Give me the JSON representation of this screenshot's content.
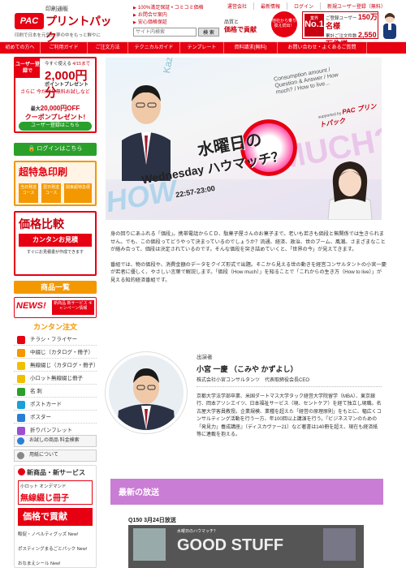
{
  "header": {
    "logo_sub": "印刷通販",
    "logo_mark": "PAC",
    "logo_text": "プリントパック",
    "logo_tagline": "印刷で日本を元気に 夢の中をもっと鮮やに",
    "links": [
      "100%満足保証 • コミコミ価格",
      "お問合せ案内",
      "安心価格保証"
    ],
    "search_placeholder": "サイト内検索",
    "search_button": "検 索",
    "top_links": [
      "運営会社",
      "最新情報",
      "ログイン",
      "新規ユーザー登録（無料）"
    ],
    "quality_label": "品質と",
    "quality_big": "価格で貢献",
    "circle_text": "他社から乗り換え続出！",
    "no1_label": "業界",
    "no1_big": "No.1",
    "no1_line1": "ご登録ユーザー",
    "no1_count": "150万名様",
    "no1_line2": "累計ご注文件数",
    "no1_orders": "2,550万件様"
  },
  "nav": {
    "items": [
      "初めての方へ",
      "ご利用ガイド",
      "ご注文方法",
      "テクニカルガイド",
      "テンプレート",
      "資料請求(無料)",
      "お問い合わせ・よくあるご質問"
    ]
  },
  "sidebar": {
    "user_tag": "ユーザー登録で",
    "user_today": "今すぐ使える",
    "user_date": "4/15まで",
    "user_amount": "2,000円分",
    "user_points": "ポイントプレゼント",
    "user_sep": "さらに 今だけ！無料お試しなど",
    "user_coupon_pre": "最大",
    "user_coupon": "20,000円OFF",
    "user_coupon2": "クーポンプレゼント!",
    "user_register": "ユーザー登録はこちら",
    "login": "ログインはこちら",
    "express": "超特急印刷",
    "express_opts": [
      "当日発送コース",
      "翌日発送コース",
      "関東超特急便"
    ],
    "compare_title": "価格比較",
    "compare_sub": "カンタンお見積",
    "compare_desc": "すぐにお見積書が作成できます",
    "list_head": "商品一覧",
    "news": "NEWS!",
    "news_sub": "新商品 新サービス キャンペーン情報",
    "kantan": "カンタン注文",
    "products": [
      {
        "label": "チラシ・フライヤー",
        "color": "#e60012"
      },
      {
        "label": "中綴じ（カタログ・冊子）",
        "color": "#f39800"
      },
      {
        "label": "無線綴じ（カタログ・冊子）",
        "color": "#f0c000"
      },
      {
        "label": "小ロット無線綴じ冊子",
        "color": "#f0c000"
      },
      {
        "label": "名 刺",
        "color": "#2aa02a"
      },
      {
        "label": "ポストカード",
        "color": "#1aa0d8"
      },
      {
        "label": "ポスター",
        "color": "#2a7fd4"
      },
      {
        "label": "折りパンフレット",
        "color": "#9a4fd0"
      }
    ],
    "bottom_links": [
      "お試しの商品 料金検索",
      "用紙について"
    ],
    "new_services": "新商品・新サービス",
    "ns_lot": "小ロット オンデマンド",
    "ns_lot_big": "無線綴じ冊子",
    "ns_price": "価格で貢献",
    "ns_links": [
      "販促・ノベルティグッズ New!",
      "ポスティングまるごとパック New!",
      "おなまえシール New!"
    ]
  },
  "hero": {
    "title1": "水曜日の",
    "title2": "ハウマッチ？",
    "day": "Wednesday",
    "time": "22:57-23:00",
    "how": "HOW",
    "much": "MUCH?",
    "eng": "Consumption amount / Question & Answer / How much? / How to live...",
    "supported": "supported by",
    "supported_brand": "PAC プリントパック",
    "name_vertical": "Kazuyoshi Komiya"
  },
  "description": {
    "p1": "身の回りにあふれる「価段」。携帯電話からＣＤ、駄菓子屋さんのお菓子まで。老いも若きも価段と無関係では生きられません。でも、この価段ってどうやって決まっているのでしょうか？流通、経済、政治、世のブーム、風潮。さまざまなことが絡み合って、価段は決定されているのです。そんな価段を突き詰めていくと、「世界の今」が見えてきます。",
    "p2": "番組では、物の価段や、消費金額のデータをクイズ形式で出題。そこから見える世の動きを経営コンサルタントの小宮一慶が若者に優しく、やさしい言葉で解説します。「価段（How much）」を知ることで「これからの生き方（How to live）」が見える知的経済番組です。"
  },
  "guest": {
    "label": "出演者",
    "name": "小宮 一慶 （こみや かずよし）",
    "title": "株式会社小宮コンサルタンツ　代表取締役会長CEO",
    "bio": "京都大学法学部卒業、米国ダートマス大学タック経営大学院留学（MBA）、東京銀行、岡本アソシエイツ、日本福祉サービス（現、セントケア）を経て独立し現職。名古屋大学客員教授。企業規模、業種を超えた「経営の原理原則」をもとに、幅広くコンサルティング活動を行う一方、年100回以上講演を行う。『ビジネスマンのための「発見力」養成講座』（ディスカヴァー21）など著書は140冊を超え、現在も経済紙等に連載を抱える。"
  },
  "latest": {
    "heading": "最新の放送",
    "episode": "Q150 3月24日放送",
    "thumb_text": "水曜日のハウマッチ？",
    "thumb_big": "GOOD STUFF"
  },
  "colors": {
    "brand_red": "#e60012",
    "orange": "#f39800",
    "green": "#2aa02a",
    "latest_purple": "#c97dd4"
  }
}
